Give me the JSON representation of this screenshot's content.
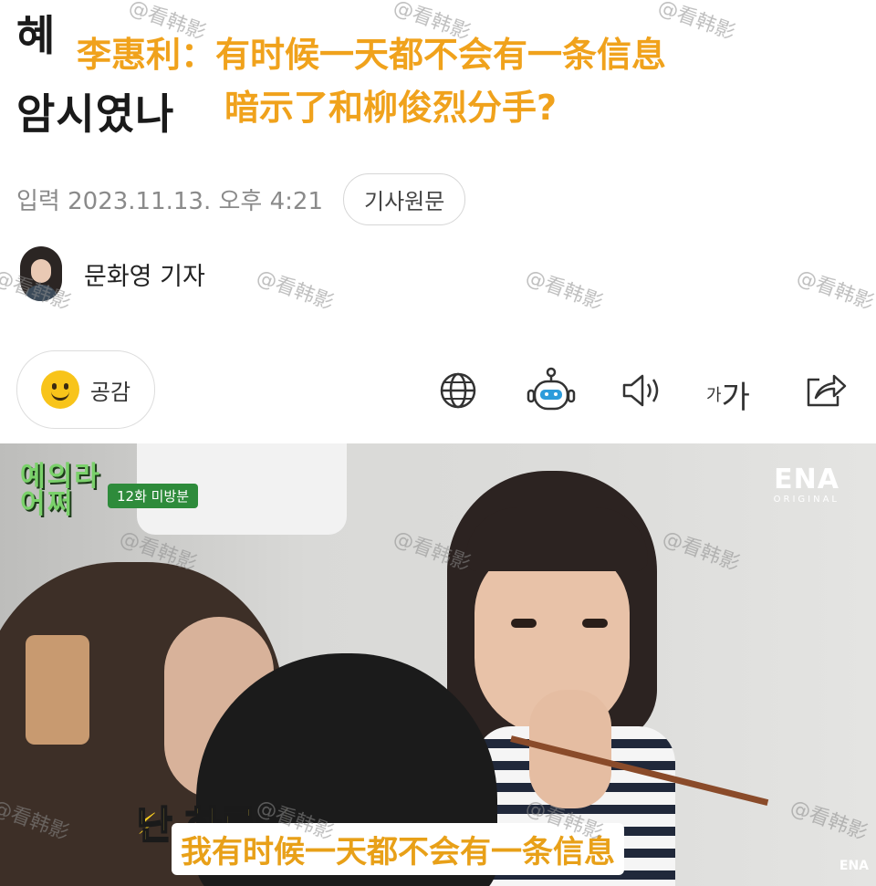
{
  "article": {
    "headline_line1": "혜",
    "headline_line2": "암시였나",
    "overlay_title_line1": "李惠利：有时候一天都不会有一条信息",
    "overlay_title_line2": "暗示了和柳俊烈分手?",
    "date_text": "입력 2023.11.13. 오후 4:21",
    "original_article_button": "기사원문",
    "reporter_name": "문화영 기자",
    "reaction_label": "공감",
    "font_size_small": "가",
    "font_size_big": "가"
  },
  "icons": {
    "reaction": "smiley-icon",
    "translate": "globe-icon",
    "summary": "robot-icon",
    "read_aloud": "speaker-icon",
    "share": "share-icon"
  },
  "watermark": "@看韩影",
  "video": {
    "show_logo": "예의라\n어쩌",
    "episode_badge": "12화 미방분",
    "channel_logo": "ENA",
    "channel_sub": "ORIGINAL",
    "channel_logo_small": "ENA",
    "subtitle_ko": "난 하루에",
    "subtitle_cn": "我有时候一天都不会有一条信息"
  },
  "colors": {
    "overlay_orange": "#f0a21c",
    "smiley_yellow": "#f8c41a",
    "subtitle_yellow": "#ffe14a"
  }
}
